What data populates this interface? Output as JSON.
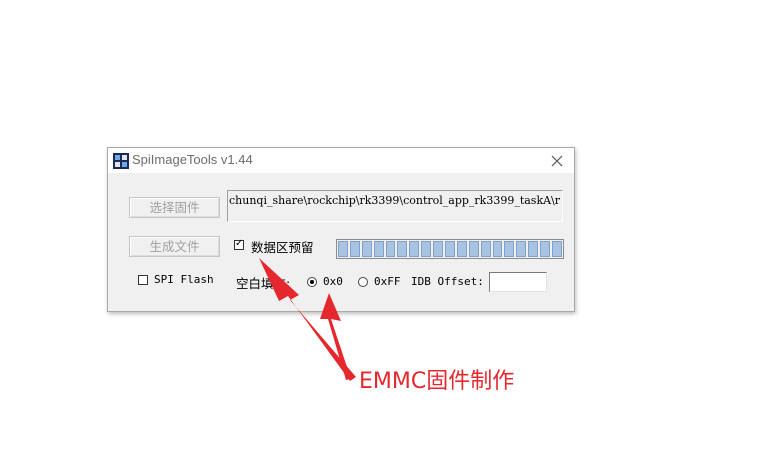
{
  "window": {
    "title": "SpiImageTools v1.44",
    "icon": "app-icon",
    "close_icon": "close-icon"
  },
  "buttons": {
    "select_firmware": "选择固件",
    "generate_file": "生成文件"
  },
  "firmware_path": "chunqi_share\\rockchip\\rk3399\\control_app_rk3399_taskA\\r",
  "options": {
    "reserve_data_area_label": "数据区预留",
    "reserve_data_area_checked": true,
    "spi_flash_label": "SPI Flash",
    "spi_flash_checked": false,
    "fill_label": "空白填充:",
    "fill_options": [
      "0x0",
      "0xFF"
    ],
    "fill_selected": "0x0",
    "idb_offset_label": "IDB Offset:",
    "idb_offset_value": ""
  },
  "progress": {
    "blocks": 19,
    "fill_fraction": 1.0,
    "color": "#a9c3e3"
  },
  "annotation": {
    "text": "EMMC固件制作",
    "color": "#e5282d"
  }
}
